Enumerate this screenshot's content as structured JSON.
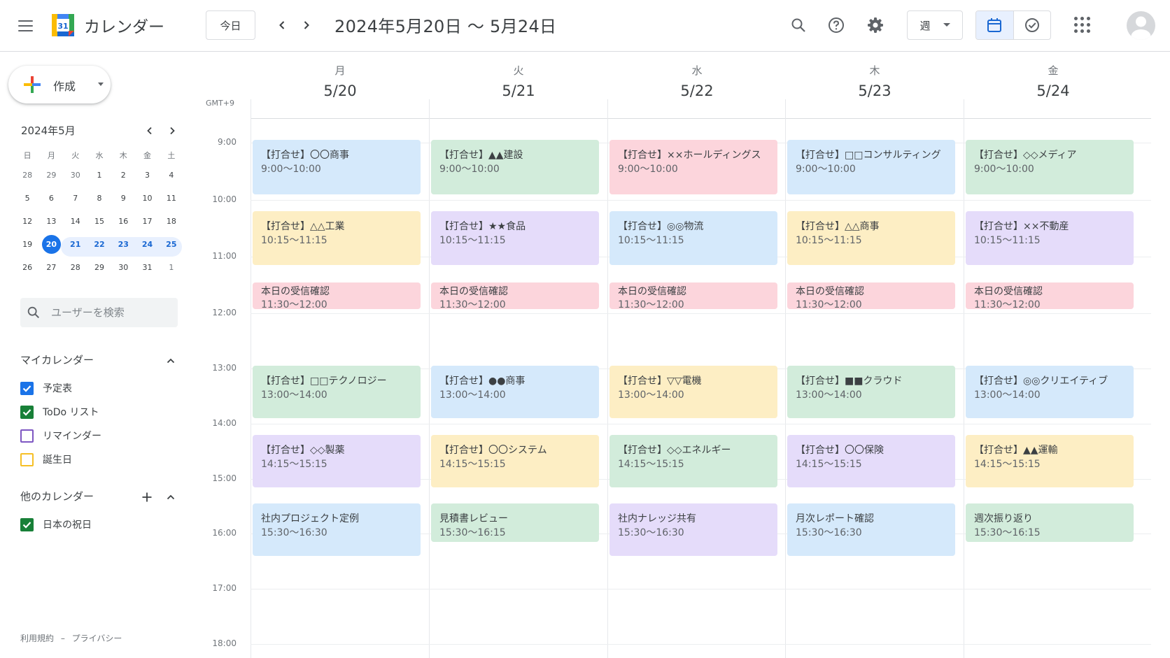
{
  "header": {
    "app_title": "カレンダー",
    "logo_day": "31",
    "today_label": "今日",
    "date_range": "2024年5月20日 〜 5月24日",
    "view_label": "週"
  },
  "sidebar": {
    "create_label": "作成",
    "mini_calendar": {
      "title": "2024年5月",
      "weekdays": [
        "日",
        "月",
        "火",
        "水",
        "木",
        "金",
        "土"
      ],
      "weeks": [
        [
          "28",
          "29",
          "30",
          "1",
          "2",
          "3",
          "4"
        ],
        [
          "5",
          "6",
          "7",
          "8",
          "9",
          "10",
          "11"
        ],
        [
          "12",
          "13",
          "14",
          "15",
          "16",
          "17",
          "18"
        ],
        [
          "19",
          "20",
          "21",
          "22",
          "23",
          "24",
          "25"
        ],
        [
          "26",
          "27",
          "28",
          "29",
          "30",
          "31",
          "1"
        ]
      ]
    },
    "search_placeholder": "ユーザーを検索",
    "my_calendars_title": "マイカレンダー",
    "my_calendars": [
      {
        "name": "予定表",
        "color": "#1a73e8",
        "checked": true
      },
      {
        "name": "ToDo リスト",
        "color": "#188038",
        "checked": true
      },
      {
        "name": "リマインダー",
        "color": "#7e57c2",
        "checked": false
      },
      {
        "name": "誕生日",
        "color": "#f6bf26",
        "checked": false
      }
    ],
    "other_calendars_title": "他のカレンダー",
    "other_calendars": [
      {
        "name": "日本の祝日",
        "color": "#188038",
        "checked": true
      }
    ],
    "footer": {
      "terms": "利用規約",
      "separator": "–",
      "privacy": "プライバシー"
    }
  },
  "week": {
    "timezone": "GMT+9",
    "days": [
      {
        "dow": "月",
        "date": "5/20"
      },
      {
        "dow": "火",
        "date": "5/21"
      },
      {
        "dow": "水",
        "date": "5/22"
      },
      {
        "dow": "木",
        "date": "5/23"
      },
      {
        "dow": "金",
        "date": "5/24"
      }
    ],
    "hours": [
      "9:00",
      "10:00",
      "11:00",
      "12:00",
      "13:00",
      "14:00",
      "15:00",
      "16:00",
      "17:00",
      "18:00"
    ],
    "events": [
      [
        {
          "title": "【打合せ】〇〇商事",
          "time": "9:00〜10:00",
          "color": "blue"
        },
        {
          "title": "【打合せ】△△工業",
          "time": "10:15〜11:15",
          "color": "yellow"
        },
        {
          "title": "本日の受信確認",
          "time": "11:30〜12:00",
          "color": "pink"
        },
        {
          "title": "【打合せ】□□テクノロジー",
          "time": "13:00〜14:00",
          "color": "green"
        },
        {
          "title": "【打合せ】◇◇製薬",
          "time": "14:15〜15:15",
          "color": "purple"
        },
        {
          "title": "社内プロジェクト定例",
          "time": "15:30〜16:30",
          "color": "blue"
        }
      ],
      [
        {
          "title": "【打合せ】▲▲建設",
          "time": "9:00〜10:00",
          "color": "green"
        },
        {
          "title": "【打合せ】★★食品",
          "time": "10:15〜11:15",
          "color": "purple"
        },
        {
          "title": "本日の受信確認",
          "time": "11:30〜12:00",
          "color": "pink"
        },
        {
          "title": "【打合せ】●●商事",
          "time": "13:00〜14:00",
          "color": "blue"
        },
        {
          "title": "【打合せ】〇〇システム",
          "time": "14:15〜15:15",
          "color": "yellow"
        },
        {
          "title": "見積書レビュー",
          "time": "15:30〜16:15",
          "color": "green"
        }
      ],
      [
        {
          "title": "【打合せ】××ホールディングス",
          "time": "9:00〜10:00",
          "color": "pink"
        },
        {
          "title": "【打合せ】◎◎物流",
          "time": "10:15〜11:15",
          "color": "blue"
        },
        {
          "title": "本日の受信確認",
          "time": "11:30〜12:00",
          "color": "pink"
        },
        {
          "title": "【打合せ】▽▽電機",
          "time": "13:00〜14:00",
          "color": "yellow"
        },
        {
          "title": "【打合せ】◇◇エネルギー",
          "time": "14:15〜15:15",
          "color": "green"
        },
        {
          "title": "社内ナレッジ共有",
          "time": "15:30〜16:30",
          "color": "purple"
        }
      ],
      [
        {
          "title": "【打合せ】□□コンサルティング",
          "time": "9:00〜10:00",
          "color": "blue"
        },
        {
          "title": "【打合せ】△△商事",
          "time": "10:15〜11:15",
          "color": "yellow"
        },
        {
          "title": "本日の受信確認",
          "time": "11:30〜12:00",
          "color": "pink"
        },
        {
          "title": "【打合せ】■■クラウド",
          "time": "13:00〜14:00",
          "color": "green"
        },
        {
          "title": "【打合せ】〇〇保険",
          "time": "14:15〜15:15",
          "color": "purple"
        },
        {
          "title": "月次レポート確認",
          "time": "15:30〜16:30",
          "color": "blue"
        }
      ],
      [
        {
          "title": "【打合せ】◇◇メディア",
          "time": "9:00〜10:00",
          "color": "green"
        },
        {
          "title": "【打合せ】××不動産",
          "time": "10:15〜11:15",
          "color": "purple"
        },
        {
          "title": "本日の受信確認",
          "time": "11:30〜12:00",
          "color": "pink"
        },
        {
          "title": "【打合せ】◎◎クリエイティブ",
          "time": "13:00〜14:00",
          "color": "blue"
        },
        {
          "title": "【打合せ】▲▲運輸",
          "time": "14:15〜15:15",
          "color": "yellow"
        },
        {
          "title": "週次振り返り",
          "time": "15:30〜16:15",
          "color": "green"
        }
      ]
    ]
  },
  "colors": {
    "accent": "#1a73e8",
    "blue": "#d5e9fb",
    "green": "#d2ecdb",
    "pink": "#fcd5dc",
    "yellow": "#fdeec4",
    "purple": "#e5dcfa"
  }
}
